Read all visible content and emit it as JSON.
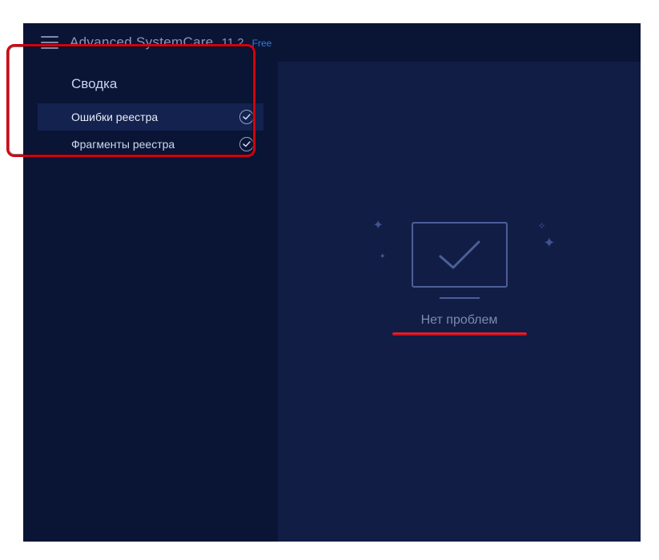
{
  "header": {
    "app_name": "Advanced SystemCare",
    "version": "11.2",
    "edition": "Free"
  },
  "sidebar": {
    "summary_title": "Сводка",
    "items": [
      {
        "label": "Ошибки реестра",
        "checked": true,
        "active": true
      },
      {
        "label": "Фрагменты реестра",
        "checked": true,
        "active": false
      }
    ]
  },
  "main": {
    "status_text": "Нет проблем"
  },
  "icons": {
    "checkmark": "check-icon",
    "hamburger": "hamburger-icon",
    "monitor_ok": "monitor-ok-icon"
  },
  "colors": {
    "bg_dark": "#0a1536",
    "panel_dark": "#111d44",
    "accent_red": "#d3000f",
    "text_muted": "#7d8ab1"
  }
}
